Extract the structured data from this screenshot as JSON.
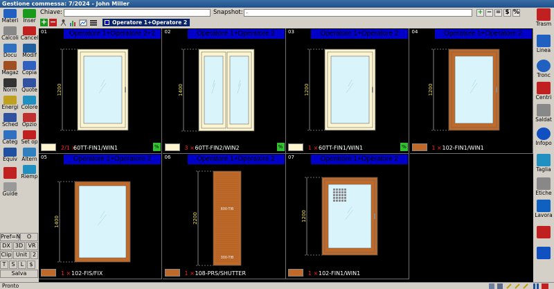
{
  "window": {
    "title": "Gestione commessa: 7/2024 - John Miller"
  },
  "toolbar": {
    "key_label": "Chiave:",
    "key_value": "",
    "snapshot_label": "Snapshot:",
    "snapshot_value": "-",
    "tab_label": "Operatore 1+Operatore 2",
    "right_buttons": [
      "+",
      "−",
      "=",
      "$",
      "%"
    ]
  },
  "left_toolbar": [
    {
      "label": "Materi",
      "icon": "materials-icon"
    },
    {
      "label": "Inser",
      "icon": "insert-icon"
    },
    {
      "label": "Calcoli",
      "icon": "calculations-icon"
    },
    {
      "label": "Cancel",
      "icon": "cancel-icon"
    },
    {
      "label": "Docu",
      "icon": "documents-icon"
    },
    {
      "label": "Modif",
      "icon": "modify-icon"
    },
    {
      "label": "Magaz",
      "icon": "warehouse-icon"
    },
    {
      "label": "Copia",
      "icon": "copy-icon"
    },
    {
      "label": "Norm",
      "icon": "norm-icon"
    },
    {
      "label": "Quote",
      "icon": "quote-icon"
    },
    {
      "label": "Energi",
      "icon": "energy-icon"
    },
    {
      "label": "Colore",
      "icon": "color-icon"
    },
    {
      "label": "Sched",
      "icon": "sheet-icon"
    },
    {
      "label": "Opzio",
      "icon": "options-icon"
    },
    {
      "label": "Categ",
      "icon": "category-icon"
    },
    {
      "label": "Set op",
      "icon": "set-operator-icon"
    },
    {
      "label": "Equiv",
      "icon": "equivalent-icon"
    },
    {
      "label": "Altern",
      "icon": "alternative-icon"
    },
    {
      "label": "",
      "icon": "exit-icon"
    },
    {
      "label": "Riemp",
      "icon": "fill-icon"
    },
    {
      "label": "Guide",
      "icon": "guide-icon"
    }
  ],
  "left_mini": [
    "Pref=No",
    "O",
    "DX",
    "3D",
    "VR",
    "Clip",
    "Unit",
    "2",
    "T",
    "S",
    "L",
    "$",
    "Salva"
  ],
  "right_toolbar": [
    {
      "label": "Trasm",
      "icon": "transmit-icon"
    },
    {
      "label": "Linea",
      "icon": "line-icon"
    },
    {
      "label": "Tronc",
      "icon": "cut-icon"
    },
    {
      "label": "Centri",
      "icon": "machining-icon"
    },
    {
      "label": "Saldat",
      "icon": "weld-icon"
    },
    {
      "label": "Infopo",
      "icon": "info-icon"
    },
    {
      "label": "Taglia",
      "icon": "cutting-icon"
    },
    {
      "label": "Etiche",
      "icon": "labels-icon"
    },
    {
      "label": "Lavora",
      "icon": "work-icon"
    },
    {
      "label": "",
      "icon": "tools-icon"
    },
    {
      "label": "",
      "icon": "stopwatch-icon"
    }
  ],
  "positions": [
    {
      "num": "01",
      "header": "Operatore 1+Operatore 2+2",
      "qty": "2/1",
      "code": "60TT-FIN1/WIN1",
      "height": "1200",
      "color": "cream",
      "type": "win1",
      "pct": "%"
    },
    {
      "num": "02",
      "header": "Operatore 1+Operatore 2",
      "qty": "3",
      "code": "60TT-FIN2/WIN2",
      "height": "1400",
      "color": "cream",
      "type": "win2",
      "pct": "%"
    },
    {
      "num": "03",
      "header": "Operatore 1+Operatore 2",
      "qty": "1",
      "code": "60TT-FIN1/WIN1",
      "height": "1200",
      "color": "cream",
      "type": "win1",
      "pct": "%"
    },
    {
      "num": "04",
      "header": "Operatore 1+Operatore 2",
      "qty": "1",
      "code": "102-FIN1/WIN1",
      "height": "1200",
      "color": "wood",
      "type": "win1w",
      "pct": ""
    },
    {
      "num": "05",
      "header": "Operatore 1+Operatore 2",
      "qty": "1",
      "code": "102-FIS/FIX",
      "height": "1400",
      "color": "wood",
      "type": "fix",
      "pct": ""
    },
    {
      "num": "06",
      "header": "Operatore 1+Operatore 2",
      "qty": "1",
      "code": "108-PRS/SHUTTER",
      "height": "2200",
      "color": "wood",
      "type": "shutter",
      "pct": "",
      "notes": [
        "600-TIB",
        "300-TIB"
      ]
    },
    {
      "num": "07",
      "header": "Operatore 1+Operatore 2",
      "qty": "1",
      "code": "102-FIN1/WIN1",
      "height": "1200",
      "color": "wood",
      "type": "win1grid",
      "pct": ""
    }
  ],
  "colors": {
    "cream": "#fdf5d0",
    "wood": "#c06a2a",
    "glass": "#d9f4fb",
    "header": "#0000c8",
    "pct": "#30c030"
  },
  "status": {
    "text": "Pronto"
  }
}
